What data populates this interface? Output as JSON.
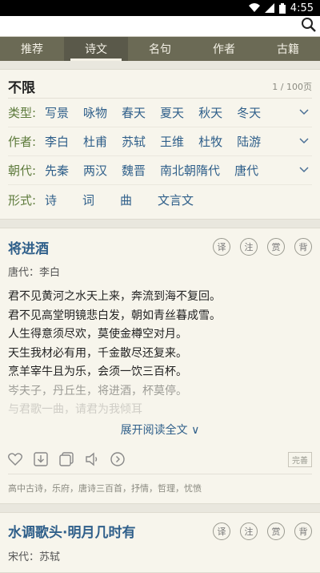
{
  "status": {
    "time": "4:55"
  },
  "search": {
    "icon": "search-icon"
  },
  "tabs": [
    {
      "label": "推荐"
    },
    {
      "label": "诗文",
      "active": true
    },
    {
      "label": "名句"
    },
    {
      "label": "作者"
    },
    {
      "label": "古籍"
    }
  ],
  "filter": {
    "title": "不限",
    "page_count": "1 / 100页",
    "rows": [
      {
        "label": "类型:",
        "options": [
          "写景",
          "咏物",
          "春天",
          "夏天",
          "秋天",
          "冬天"
        ],
        "expandable": true
      },
      {
        "label": "作者:",
        "options": [
          "李白",
          "杜甫",
          "苏轼",
          "王维",
          "杜牧",
          "陆游"
        ],
        "expandable": true
      },
      {
        "label": "朝代:",
        "options": [
          "先秦",
          "两汉",
          "魏晋",
          "南北朝隋代",
          "唐代"
        ],
        "expandable": true
      },
      {
        "label": "形式:",
        "options": [
          "诗",
          "词",
          "曲",
          "文言文"
        ],
        "expandable": false
      }
    ]
  },
  "badges": [
    "译",
    "注",
    "赏",
    "背"
  ],
  "poems": [
    {
      "title": "将进酒",
      "author": "唐代：李白",
      "lines": [
        "君不见黄河之水天上来，奔流到海不复回。",
        "君不见高堂明镜悲白发，朝如青丝暮成雪。",
        "人生得意须尽欢，莫使金樽空对月。",
        "天生我材必有用，千金散尽还复来。",
        "烹羊宰牛且为乐，会须一饮三百杯。",
        "岑夫子，丹丘生，将进酒，杯莫停。",
        "与君歌一曲，请君为我倾耳"
      ],
      "expand_label": "展开阅读全文 ∨",
      "perfect_label": "完善",
      "tags": "高中古诗，乐府，唐诗三百首，抒情，哲理，忧愤"
    },
    {
      "title": "水调歌头·明月几时有",
      "author": "宋代：苏轼"
    }
  ]
}
